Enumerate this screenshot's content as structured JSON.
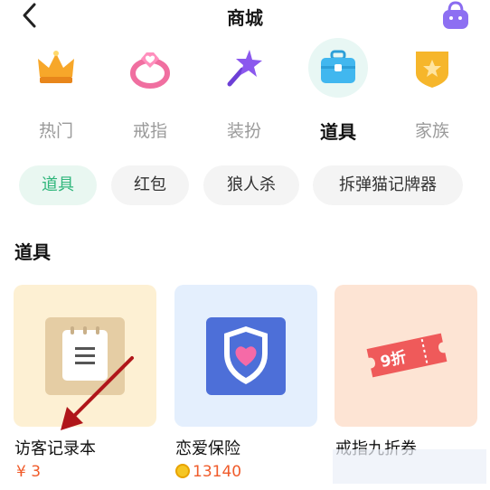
{
  "header": {
    "title": "商城",
    "back_icon": "chevron-left-icon",
    "right_icon": "bag-icon"
  },
  "categories": [
    {
      "label": "热门",
      "icon": "crown-icon",
      "active": false
    },
    {
      "label": "戒指",
      "icon": "ring-icon",
      "active": false
    },
    {
      "label": "装扮",
      "icon": "magic-wand-icon",
      "active": false
    },
    {
      "label": "道具",
      "icon": "briefcase-icon",
      "active": true
    },
    {
      "label": "家族",
      "icon": "badge-icon",
      "active": false
    }
  ],
  "subtabs": [
    {
      "label": "道具",
      "active": true
    },
    {
      "label": "红包",
      "active": false
    },
    {
      "label": "狼人杀",
      "active": false
    },
    {
      "label": "拆弹猫记牌器",
      "active": false
    }
  ],
  "section": {
    "title": "道具"
  },
  "products": [
    {
      "name": "访客记录本",
      "price": "¥ 3",
      "currency": "rmb",
      "icon": "notebook-icon",
      "bg": "#fdf0d3"
    },
    {
      "name": "恋爱保险",
      "price": "13140",
      "currency": "coin",
      "icon": "heart-shield-icon",
      "bg": "#e4effd"
    },
    {
      "name": "戒指九折券",
      "price": "",
      "currency": "",
      "icon": "coupon-icon",
      "bg": "#fde4d4",
      "coupon_text": "9折"
    }
  ],
  "colors": {
    "accent": "#2fb67b",
    "price": "#f05b2a",
    "annotation_arrow": "#b0161a"
  }
}
